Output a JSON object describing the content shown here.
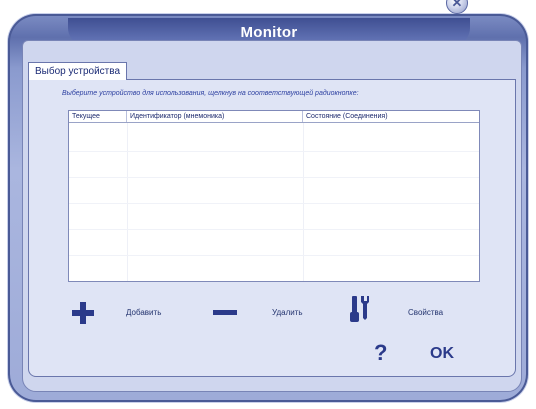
{
  "window": {
    "title": "Monitor",
    "close_glyph": "✕"
  },
  "tabs": [
    {
      "label": "Выбор устройства"
    }
  ],
  "hint": "Выберите устройство для использования, щелкнув на соответствующей радиокнопке:",
  "table": {
    "columns": [
      "Текущее",
      "Идентификатор (мнемоника)",
      "Состояние (Соединения)"
    ],
    "rows": []
  },
  "toolbar": {
    "add_label": "Добавить",
    "delete_label": "Удалить",
    "properties_label": "Свойства",
    "add_icon": "plus-icon",
    "delete_icon": "minus-icon",
    "properties_icon": "tools-icon"
  },
  "footer": {
    "help_label": "?",
    "ok_label": "OK"
  },
  "colors": {
    "accent": "#2b3a8a",
    "window": "#9eabd8",
    "title_bar": "#4a5a9e"
  }
}
